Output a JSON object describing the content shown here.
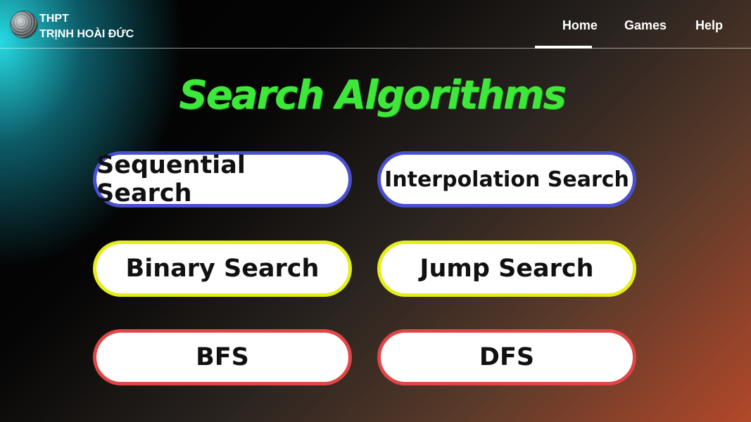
{
  "header": {
    "logo_icon": "globe-icon",
    "logo_line1": "THPT",
    "logo_line2": "TRỊNH HOÀI ĐỨC",
    "nav": {
      "home": "Home",
      "games": "Games",
      "help": "Help"
    },
    "active_nav": "Home"
  },
  "main": {
    "title": "Search Algorithms",
    "buttons": [
      {
        "label": "Sequential Search",
        "border_color": "#4a4fd0"
      },
      {
        "label": "Interpolation Search",
        "border_color": "#4a4fd0"
      },
      {
        "label": "Binary Search",
        "border_color": "#e6ee17"
      },
      {
        "label": "Jump Search",
        "border_color": "#e6ee17"
      },
      {
        "label": "BFS",
        "border_color": "#e24545"
      },
      {
        "label": "DFS",
        "border_color": "#e24545"
      }
    ]
  },
  "colors": {
    "title": "#3ee83a",
    "accent_cyan": "#28e6f0",
    "accent_orange": "#b3482a"
  }
}
